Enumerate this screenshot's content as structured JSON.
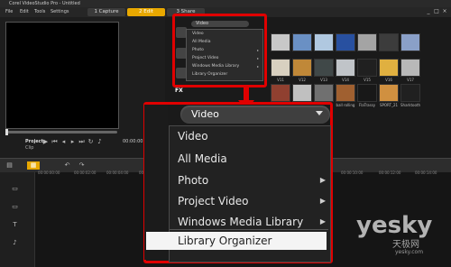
{
  "window": {
    "title": "Corel VideoStudio Pro - Untitled"
  },
  "menu": [
    "File",
    "Edit",
    "Tools",
    "Settings"
  ],
  "steps": [
    {
      "label": "1  Capture",
      "active": false
    },
    {
      "label": "2  Edit",
      "active": true
    },
    {
      "label": "3  Share",
      "active": false
    }
  ],
  "window_controls": [
    "_",
    "□",
    "×"
  ],
  "preview": {
    "project_label": "Project",
    "clip_label": "Clip",
    "timecode": "00:00:00:00"
  },
  "library": {
    "dropdown_value": "Video",
    "fx_label": "FX",
    "small_menu": [
      {
        "label": "Video",
        "submenu": false
      },
      {
        "label": "All Media",
        "submenu": false
      },
      {
        "label": "Photo",
        "submenu": true
      },
      {
        "label": "Project Video",
        "submenu": true
      },
      {
        "label": "Windows Media Library",
        "submenu": true
      },
      {
        "label": "Library Organizer",
        "submenu": false
      }
    ],
    "thumb_labels": [
      "V11",
      "V12",
      "V13",
      "V14",
      "V15",
      "V16",
      "V17"
    ],
    "thumb_labels_row3": [
      "ball rolling",
      "FlaTrassy",
      "SPORT_21",
      "Sharktooth"
    ]
  },
  "timeline": {
    "ruler": [
      "00:00:00:00",
      "00:00:02:00",
      "00:00:04:00",
      "00:00:06:00",
      "00:00:08:00",
      "00:00:10:00",
      "00:00:12:00",
      "00:00:14:00"
    ]
  },
  "zoom_menu": {
    "dropdown_value": "Video",
    "items": [
      {
        "label": "Video",
        "submenu": false
      },
      {
        "label": "All Media",
        "submenu": false
      },
      {
        "label": "Photo",
        "submenu": true
      },
      {
        "label": "Project Video",
        "submenu": true
      },
      {
        "label": "Windows Media Library",
        "submenu": true
      }
    ],
    "highlighted_item": "Library Organizer"
  },
  "watermark": {
    "brand": "yesky",
    "sub": "天极网",
    "domain": "yesky.com"
  },
  "colors": {
    "accent": "#e8a800",
    "callout": "#e00000"
  }
}
